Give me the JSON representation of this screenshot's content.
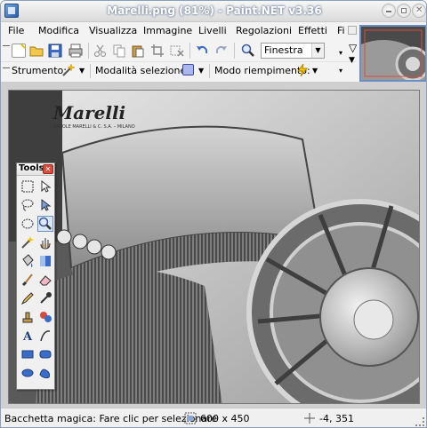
{
  "window": {
    "title": "Marelli.png (81%) - Paint.NET v3.36"
  },
  "menu": {
    "items": [
      "File",
      "Modifica",
      "Visualizza",
      "Immagine",
      "Livelli",
      "Regolazioni",
      "Effetti",
      "Fi"
    ]
  },
  "toolbar": {
    "zoom_select_value": "Finestra"
  },
  "options": {
    "tool_label": "Strumento:",
    "selection_mode_label": "Modalità selezione:",
    "fill_mode_label": "Modo riempimento:"
  },
  "tools_window": {
    "title": "Tools",
    "tools": [
      "rectangle-select",
      "move-selection",
      "lasso-select",
      "move-selected-pixels",
      "ellipse-select",
      "zoom",
      "magic-wand",
      "pan",
      "paint-bucket",
      "gradient",
      "paintbrush",
      "eraser",
      "pencil",
      "color-picker",
      "clone-stamp",
      "recolor",
      "text",
      "line-curve",
      "rectangle",
      "rounded-rectangle",
      "ellipse",
      "freeform-shape"
    ]
  },
  "image": {
    "caption_line1": "Marelli",
    "caption_line2": "ERCOLE MARELLI & C. S.A. – MILANO"
  },
  "status": {
    "hint": "Bacchetta magica: Fare clic per selezionare",
    "image_size": "600 x 450",
    "cursor_position": "-4, 351"
  },
  "colors": {
    "title_glow": "#7b8aa5",
    "selection_blue": "#6d8ec0",
    "close_red": "#d84b3d"
  }
}
